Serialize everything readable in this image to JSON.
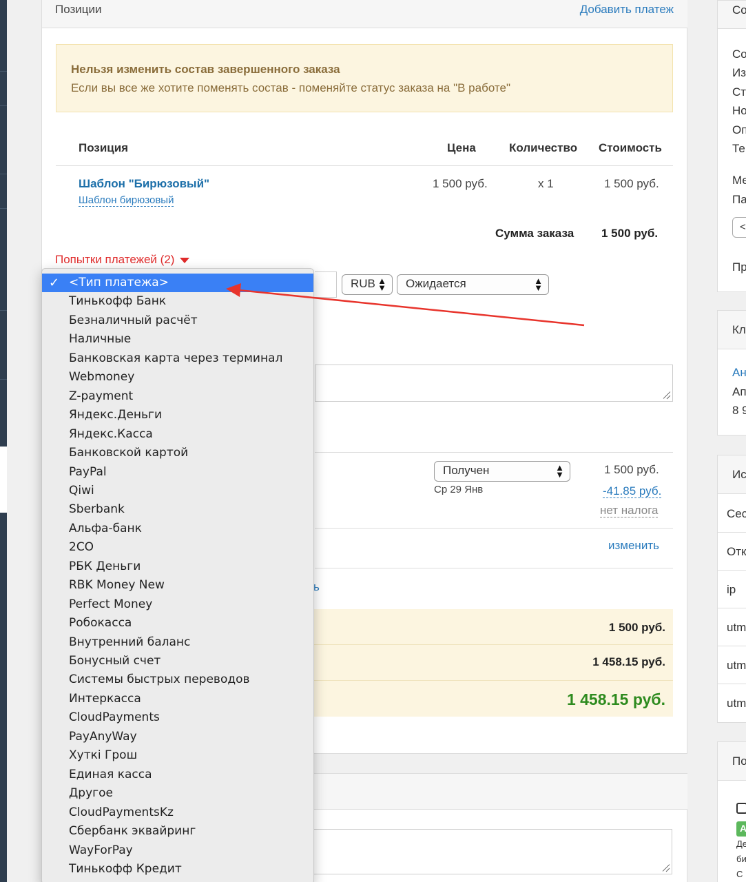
{
  "positions_panel": {
    "title": "Позиции",
    "add_payment_link": "Добавить платеж"
  },
  "warning": {
    "title": "Нельзя изменить состав завершенного заказа",
    "text": "Если вы все же хотите поменять состав - поменяйте статус заказа на \"В работе\""
  },
  "table": {
    "headers": [
      "Позиция",
      "Цена",
      "Количество",
      "Стоимость"
    ],
    "rows": [
      {
        "name": "Шаблон \"Бирюзовый\"",
        "sub": "Шаблон бирюзовый",
        "price": "1 500 руб.",
        "qty": "x 1",
        "cost": "1 500 руб."
      }
    ],
    "total_label": "Сумма заказа",
    "total_value": "1 500 руб."
  },
  "payment_attempts": {
    "label": "Попытки платежей (2)",
    "currency": "RUB",
    "status": "Ожидается"
  },
  "payment_row": {
    "status": "Получен",
    "date": "Ср 29 Янв",
    "amount": "1 500 руб.",
    "fee": "-41.85 руб.",
    "tax": "нет налога"
  },
  "change_link": "изменить",
  "partial_link_tail": "ь",
  "summary": {
    "row1": "1 500 руб.",
    "row2": "1 458.15 руб.",
    "row3": "1 458.15 руб.",
    "row3_color": "#2e8b1f"
  },
  "dropdown": {
    "selected": "<Тип платежа>",
    "options": [
      "<Тип платежа>",
      "Тинькофф Банк",
      "Безналичный расчёт",
      "Наличные",
      "Банковская карта через терминал",
      "Webmoney",
      "Z-payment",
      "Яндекс.Деньги",
      "Яндекс.Касса",
      "Банковской картой",
      "PayPal",
      "Qiwi",
      "Sberbank",
      "Альфа-банк",
      "2CO",
      "РБК Деньги",
      "RBK Money New",
      "Perfect Money",
      "Робокасса",
      "Внутренний баланс",
      "Бонусный счет",
      "Системы быстрых переводов",
      "Интеркасса",
      "CloudPayments",
      "PayAnyWay",
      "Хуткі Грош",
      "Единая касса",
      "Другое",
      "CloudPaymentsKz",
      "Сбербанк эквайринг",
      "WayForPay",
      "Тинькофф Кредит"
    ],
    "highlight_color": "#3a80f5"
  },
  "right_column": {
    "panel1_title": "Со",
    "panel1_lines": [
      "Со",
      "Из",
      "Ст",
      "Но",
      "Оп",
      "Те"
    ],
    "panel1_lines2": [
      "Ме",
      "Па"
    ],
    "panel1_btn": "<",
    "panel1_last": "Пр",
    "panel2_title": "Кл",
    "panel2_link": "Ан",
    "panel2_lines": [
      "Ап",
      "8 9"
    ],
    "panel3_title": "Ис",
    "panel3_rows": [
      "Сес",
      "Отк",
      "ip",
      "utm",
      "utm",
      "utm"
    ],
    "panel4_title": "По",
    "panel4_badge": "А",
    "panel4_lines": [
      "Де",
      "би",
      "С"
    ]
  },
  "annotation": {
    "arrow_color": "#e8342c"
  }
}
